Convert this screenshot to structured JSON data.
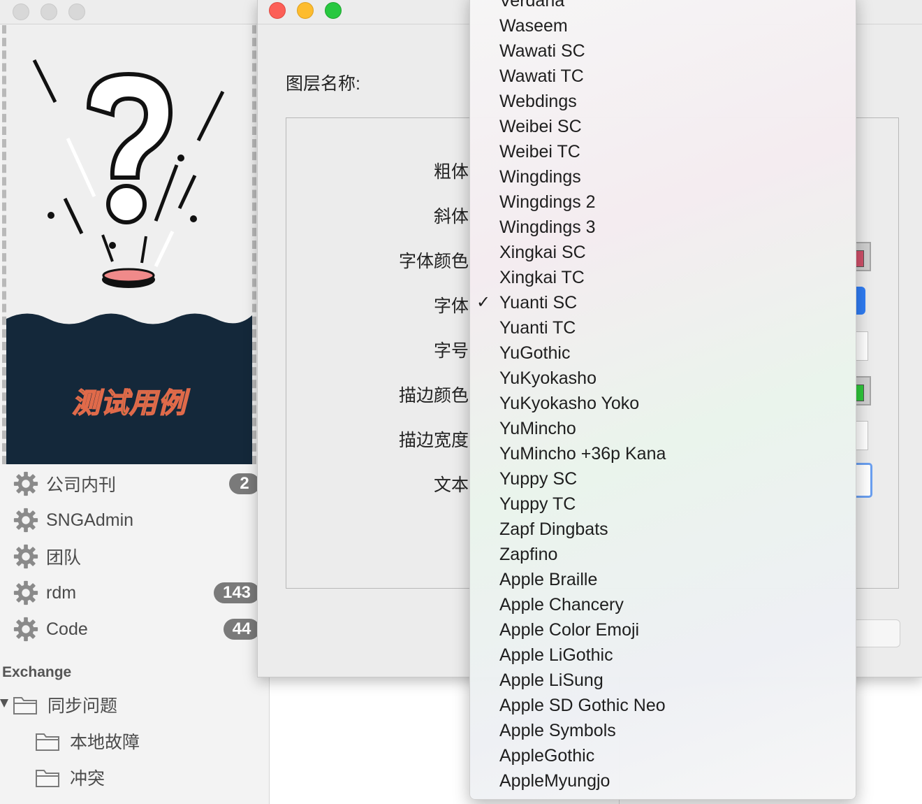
{
  "sidebar": {
    "accounts": [
      {
        "label": "公司内刊",
        "badge": "2"
      },
      {
        "label": "SNGAdmin",
        "badge": ""
      },
      {
        "label": "团队",
        "badge": ""
      },
      {
        "label": "rdm",
        "badge": "143"
      },
      {
        "label": "Code",
        "badge": "44"
      }
    ],
    "section_title": "Exchange",
    "folders": [
      {
        "label": "同步问题"
      },
      {
        "label": "本地故障"
      },
      {
        "label": "冲突"
      }
    ]
  },
  "preview": {
    "caption": "测试用例",
    "caption_stroke_color": "#e06a4a",
    "water_color": "#14283a"
  },
  "dialog": {
    "layer_name_label": "图层名称:",
    "fields": {
      "bold": "粗体",
      "italic": "斜体",
      "font_color": "字体颜色",
      "font": "字体",
      "font_size": "字号",
      "stroke_color": "描边颜色",
      "stroke_width": "描边宽度",
      "text": "文本"
    },
    "font_color_value": "#d0506a",
    "stroke_color_value": "#2ec83a"
  },
  "font_menu": {
    "selected": "Yuanti SC",
    "items": [
      "Verdana",
      "Waseem",
      "Wawati SC",
      "Wawati TC",
      "Webdings",
      "Weibei SC",
      "Weibei TC",
      "Wingdings",
      "Wingdings 2",
      "Wingdings 3",
      "Xingkai SC",
      "Xingkai TC",
      "Yuanti SC",
      "Yuanti TC",
      "YuGothic",
      "YuKyokasho",
      "YuKyokasho Yoko",
      "YuMincho",
      "YuMincho +36p Kana",
      "Yuppy SC",
      "Yuppy TC",
      "Zapf Dingbats",
      "Zapfino",
      "Apple Braille",
      "Apple Chancery",
      "Apple Color Emoji",
      "Apple LiGothic",
      "Apple LiSung",
      "Apple SD Gothic Neo",
      "Apple Symbols",
      "AppleGothic",
      "AppleMyungjo"
    ]
  }
}
